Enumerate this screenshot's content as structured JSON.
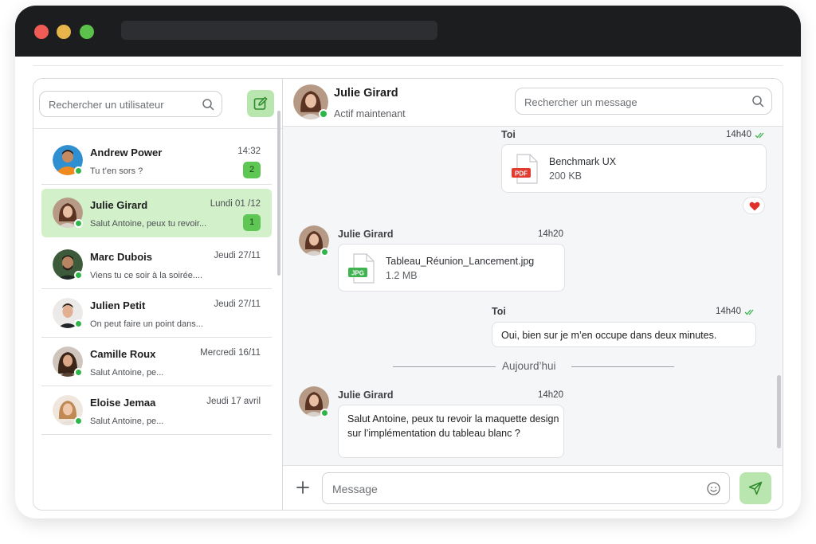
{
  "sidebar": {
    "search_placeholder": "Rechercher un utilisateur",
    "conversations": [
      {
        "name": "Andrew Power",
        "time": "14:32",
        "preview": "Tu t’en sors ?",
        "badge": "2",
        "online": true
      },
      {
        "name": "Julie Girard",
        "time": "Lundi 01 /12",
        "preview": "Salut Antoine, peux tu revoir...",
        "badge": "1",
        "online": true,
        "active": true
      },
      {
        "name": "Marc Dubois",
        "time": "Jeudi 27/11",
        "preview": "Viens tu ce soir à la soirée....",
        "online": true
      },
      {
        "name": "Julien Petit",
        "time": "Jeudi 27/11",
        "preview": "On peut faire un point dans...",
        "online": true
      },
      {
        "name": "Camille Roux",
        "time": "Mercredi 16/11",
        "preview": "Salut Antoine, pe...",
        "online": true
      },
      {
        "name": "Eloise Jemaa",
        "time": "Jeudi 17 avril",
        "preview": "Salut Antoine, pe...",
        "online": true
      }
    ]
  },
  "chat": {
    "contact_name": "Julie Girard",
    "contact_status": "Actif maintenant",
    "search_placeholder": "Rechercher un message",
    "messages": [
      {
        "sender": "Toi",
        "time": "14h40",
        "file_name": "Benchmark UX",
        "file_size": "200 KB",
        "file_type": "PDF"
      },
      {
        "sender": "Julie Girard",
        "time": "14h20",
        "file_name": "Tableau_Réunion_Lancement.jpg",
        "file_size": "1.2 MB",
        "file_type": "JPG"
      },
      {
        "sender": "Toi",
        "time": "14h40",
        "text": "Oui, bien sur je m’en occupe dans deux minutes."
      },
      {
        "sender": "Julie Girard",
        "time": "14h20",
        "text": "Salut Antoine, peux tu revoir la maquette design sur l’implémentation du tableau blanc ?"
      }
    ],
    "divider_label": "Aujourd’hui",
    "composer_placeholder": "Message"
  },
  "colors": {
    "accent_light": "#b9e6ae",
    "active_row": "#d2f0c9",
    "badge": "#5ec653",
    "online": "#2fb54a",
    "pdf": "#e23b30",
    "jpg": "#3fb34f",
    "read_ticks": "#3fb34f"
  }
}
